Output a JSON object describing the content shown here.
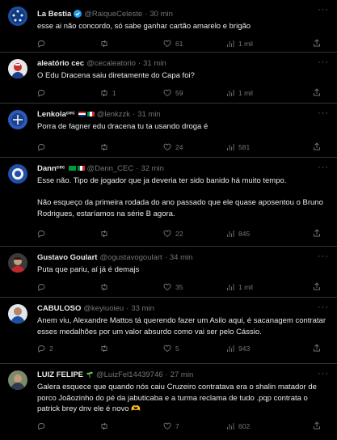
{
  "tweets": [
    {
      "name": "La Bestia",
      "handle": "@RaiqueCeleste",
      "time": "30 min",
      "text": "esse ai não concordo, só sabe ganhar cartão amarelo e brigão",
      "replies": "",
      "retweets": "",
      "likes": "61",
      "views": "1 mil",
      "verified": true
    },
    {
      "name": "aleatório cec",
      "handle": "@cecaleatorio",
      "time": "31 min",
      "text": "O Edu Dracena saiu diretamente do Capa foi?",
      "replies": "",
      "retweets": "1",
      "likes": "59",
      "views": "1 mil"
    },
    {
      "name": "Lenkolaᶜᵉᶜ",
      "handle": "@lenkzzk",
      "time": "31 min",
      "text": "Porra de fagner edu dracena tu ta usando droga é",
      "replies": "",
      "retweets": "",
      "likes": "24",
      "views": "581"
    },
    {
      "name": "Dannᶜᵉᶜ",
      "handle": "@Dann_CEC",
      "time": "32 min",
      "text": "Esse não. Tipo de jogador que ja deveria ter sido banido há muito tempo.\n\nNão esqueço da primeira rodada do ano passado que ele quase aposentou o Bruno Rodrigues, estaríamos na série B agora.",
      "replies": "",
      "retweets": "",
      "likes": "22",
      "views": "845"
    },
    {
      "name": "Gustavo Goulart",
      "handle": "@ogustavogoulart",
      "time": "34 min",
      "text": "Puta que pariu, aí já é demajs",
      "replies": "",
      "retweets": "",
      "likes": "35",
      "views": "1 mil"
    },
    {
      "name": "CABULOSO",
      "handle": "@keyiuoieu",
      "time": "33 min",
      "text": "Anem viu, Alexandre Mattos tá querendo fazer um Asilo aqui, é sacanagem contratar esses medalhões por um valor absurdo como vai ser pelo Cássio.",
      "replies": "2",
      "retweets": "",
      "likes": "5",
      "views": "943"
    },
    {
      "name": "LUIZ FELIPE",
      "handle": "@LuizFel14439746",
      "time": "27 min",
      "text": "Galera esquece que quando nós caiu Cruzeiro contratava era o shalin matador de porco Joãozinho do pé da jabuticaba e a turma reclama de tudo .pqp contrata o patrick brey dnv ele é novo 🫶",
      "replies": "",
      "retweets": "",
      "likes": "7",
      "views": "602"
    }
  ]
}
